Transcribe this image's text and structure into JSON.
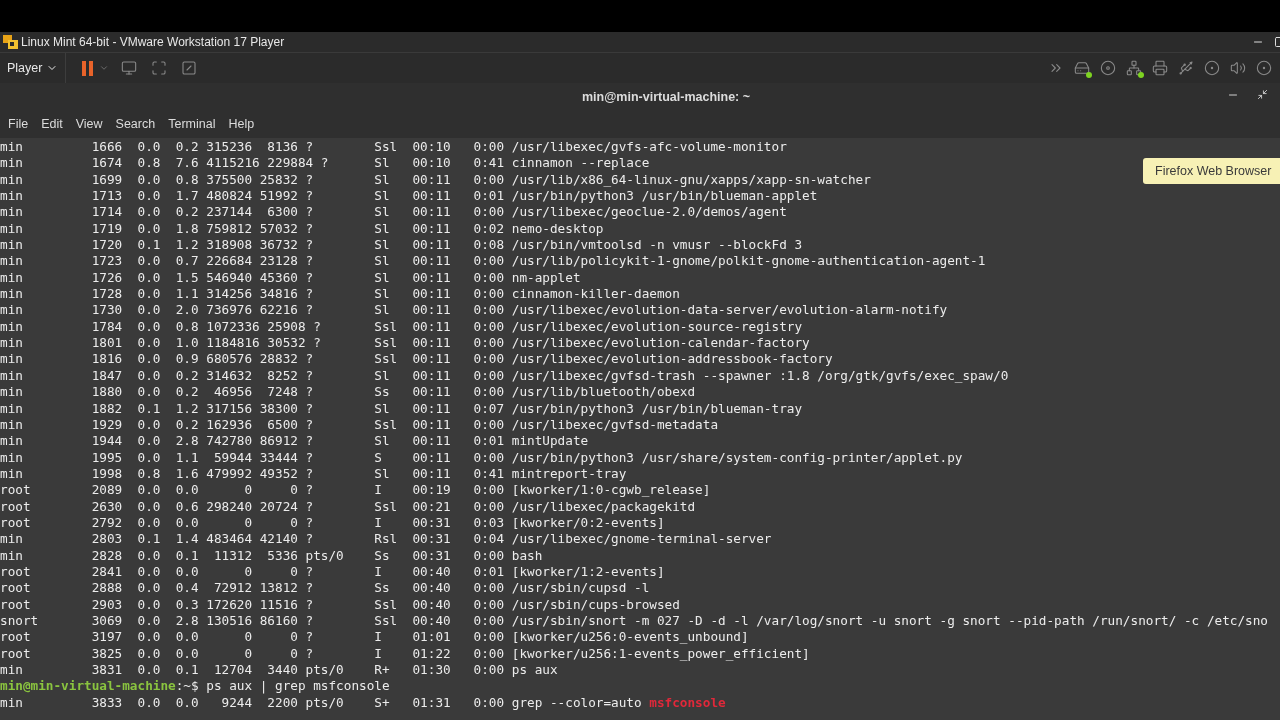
{
  "window": {
    "title": "Linux Mint 64-bit - VMware Workstation 17 Player"
  },
  "toolbar": {
    "player_menu": "Player"
  },
  "terminal": {
    "title": "min@min-virtual-machine: ~",
    "menu": [
      "File",
      "Edit",
      "View",
      "Search",
      "Terminal",
      "Help"
    ],
    "lines": [
      {
        "kind": "output",
        "text": "min         1666  0.0  0.2 315236  8136 ?        Ssl  00:10   0:00 /usr/libexec/gvfs-afc-volume-monitor"
      },
      {
        "kind": "output",
        "text": "min         1674  0.8  7.6 4115216 229884 ?      Sl   00:10   0:41 cinnamon --replace"
      },
      {
        "kind": "output",
        "text": "min         1699  0.0  0.8 375500 25832 ?        Sl   00:11   0:00 /usr/lib/x86_64-linux-gnu/xapps/xapp-sn-watcher"
      },
      {
        "kind": "output",
        "text": "min         1713  0.0  1.7 480824 51992 ?        Sl   00:11   0:01 /usr/bin/python3 /usr/bin/blueman-applet"
      },
      {
        "kind": "output",
        "text": "min         1714  0.0  0.2 237144  6300 ?        Sl   00:11   0:00 /usr/libexec/geoclue-2.0/demos/agent"
      },
      {
        "kind": "output",
        "text": "min         1719  0.0  1.8 759812 57032 ?        Sl   00:11   0:02 nemo-desktop"
      },
      {
        "kind": "output",
        "text": "min         1720  0.1  1.2 318908 36732 ?        Sl   00:11   0:08 /usr/bin/vmtoolsd -n vmusr --blockFd 3"
      },
      {
        "kind": "output",
        "text": "min         1723  0.0  0.7 226684 23128 ?        Sl   00:11   0:00 /usr/lib/policykit-1-gnome/polkit-gnome-authentication-agent-1"
      },
      {
        "kind": "output",
        "text": "min         1726  0.0  1.5 546940 45360 ?        Sl   00:11   0:00 nm-applet"
      },
      {
        "kind": "output",
        "text": "min         1728  0.0  1.1 314256 34816 ?        Sl   00:11   0:00 cinnamon-killer-daemon"
      },
      {
        "kind": "output",
        "text": "min         1730  0.0  2.0 736976 62216 ?        Sl   00:11   0:00 /usr/libexec/evolution-data-server/evolution-alarm-notify"
      },
      {
        "kind": "output",
        "text": "min         1784  0.0  0.8 1072336 25908 ?       Ssl  00:11   0:00 /usr/libexec/evolution-source-registry"
      },
      {
        "kind": "output",
        "text": "min         1801  0.0  1.0 1184816 30532 ?       Ssl  00:11   0:00 /usr/libexec/evolution-calendar-factory"
      },
      {
        "kind": "output",
        "text": "min         1816  0.0  0.9 680576 28832 ?        Ssl  00:11   0:00 /usr/libexec/evolution-addressbook-factory"
      },
      {
        "kind": "output",
        "text": "min         1847  0.0  0.2 314632  8252 ?        Sl   00:11   0:00 /usr/libexec/gvfsd-trash --spawner :1.8 /org/gtk/gvfs/exec_spaw/0"
      },
      {
        "kind": "output",
        "text": "min         1880  0.0  0.2  46956  7248 ?        Ss   00:11   0:00 /usr/lib/bluetooth/obexd"
      },
      {
        "kind": "output",
        "text": "min         1882  0.1  1.2 317156 38300 ?        Sl   00:11   0:07 /usr/bin/python3 /usr/bin/blueman-tray"
      },
      {
        "kind": "output",
        "text": "min         1929  0.0  0.2 162936  6500 ?        Ssl  00:11   0:00 /usr/libexec/gvfsd-metadata"
      },
      {
        "kind": "output",
        "text": "min         1944  0.0  2.8 742780 86912 ?        Sl   00:11   0:01 mintUpdate"
      },
      {
        "kind": "output",
        "text": "min         1995  0.0  1.1  59944 33444 ?        S    00:11   0:00 /usr/bin/python3 /usr/share/system-config-printer/applet.py"
      },
      {
        "kind": "output",
        "text": "min         1998  0.8  1.6 479992 49352 ?        Sl   00:11   0:41 mintreport-tray"
      },
      {
        "kind": "output",
        "text": "root        2089  0.0  0.0      0     0 ?        I    00:19   0:00 [kworker/1:0-cgwb_release]"
      },
      {
        "kind": "output",
        "text": "root        2630  0.0  0.6 298240 20724 ?        Ssl  00:21   0:00 /usr/libexec/packagekitd"
      },
      {
        "kind": "output",
        "text": "root        2792  0.0  0.0      0     0 ?        I    00:31   0:03 [kworker/0:2-events]"
      },
      {
        "kind": "output",
        "text": "min         2803  0.1  1.4 483464 42140 ?        Rsl  00:31   0:04 /usr/libexec/gnome-terminal-server"
      },
      {
        "kind": "output",
        "text": "min         2828  0.0  0.1  11312  5336 pts/0    Ss   00:31   0:00 bash"
      },
      {
        "kind": "output",
        "text": "root        2841  0.0  0.0      0     0 ?        I    00:40   0:01 [kworker/1:2-events]"
      },
      {
        "kind": "output",
        "text": "root        2888  0.0  0.4  72912 13812 ?        Ss   00:40   0:00 /usr/sbin/cupsd -l"
      },
      {
        "kind": "output",
        "text": "root        2903  0.0  0.3 172620 11516 ?        Ssl  00:40   0:00 /usr/sbin/cups-browsed"
      },
      {
        "kind": "output",
        "text": "snort       3069  0.0  2.8 130516 86160 ?        Ssl  00:40   0:00 /usr/sbin/snort -m 027 -D -d -l /var/log/snort -u snort -g snort --pid-path /run/snort/ -c /etc/sno"
      },
      {
        "kind": "output",
        "text": "root        3197  0.0  0.0      0     0 ?        I    01:01   0:00 [kworker/u256:0-events_unbound]"
      },
      {
        "kind": "output",
        "text": "root        3825  0.0  0.0      0     0 ?        I    01:22   0:00 [kworker/u256:1-events_power_efficient]"
      },
      {
        "kind": "output",
        "text": "min         3831  0.0  0.1  12704  3440 pts/0    R+   01:30   0:00 ps aux"
      },
      {
        "kind": "prompt",
        "user": "min@min-virtual-machine",
        "symbol": ":~$",
        "command": "ps aux | grep msfconsole"
      },
      {
        "kind": "match",
        "text": "min         3833  0.0  0.0   9244  2200 pts/0    S+   01:31   0:00 grep --color=auto",
        "match": "msfconsole"
      }
    ]
  },
  "tooltip": "Firefox Web Browser"
}
